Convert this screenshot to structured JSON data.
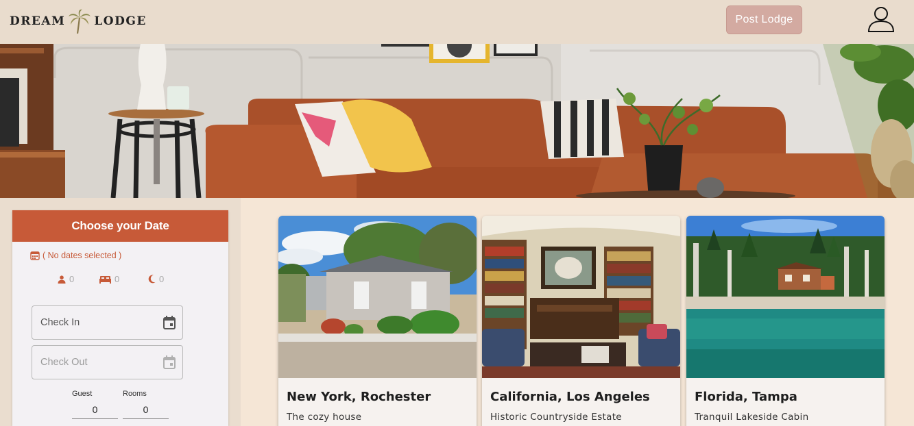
{
  "header": {
    "logo_left": "DREAM",
    "logo_right": "LODGE",
    "post_button": "Post Lodge",
    "profile_icon": "user-outline-icon"
  },
  "hero": {
    "image_description_icon": "living-room-hero-image"
  },
  "booking": {
    "title": "Choose your Date",
    "no_dates": "( No dates selected )",
    "guests_count": "0",
    "beds_count": "0",
    "nights_count": "0",
    "check_in_label": "Check In",
    "check_out_label": "Check Out",
    "guest_label": "Guest",
    "rooms_label": "Rooms",
    "guest_value": "0",
    "rooms_value": "0"
  },
  "listings": [
    {
      "title": "New York, Rochester",
      "subtitle": "The cozy house"
    },
    {
      "title": "California, Los Angeles",
      "subtitle": "Historic Countryside Estate"
    },
    {
      "title": "Florida, Tampa",
      "subtitle": "Tranquil Lakeside Cabin"
    }
  ],
  "colors": {
    "accent": "#c75a38",
    "header_bg": "#e9dccd",
    "page_bg": "#f5e6d6",
    "post_button_bg": "#d3aaa1"
  }
}
